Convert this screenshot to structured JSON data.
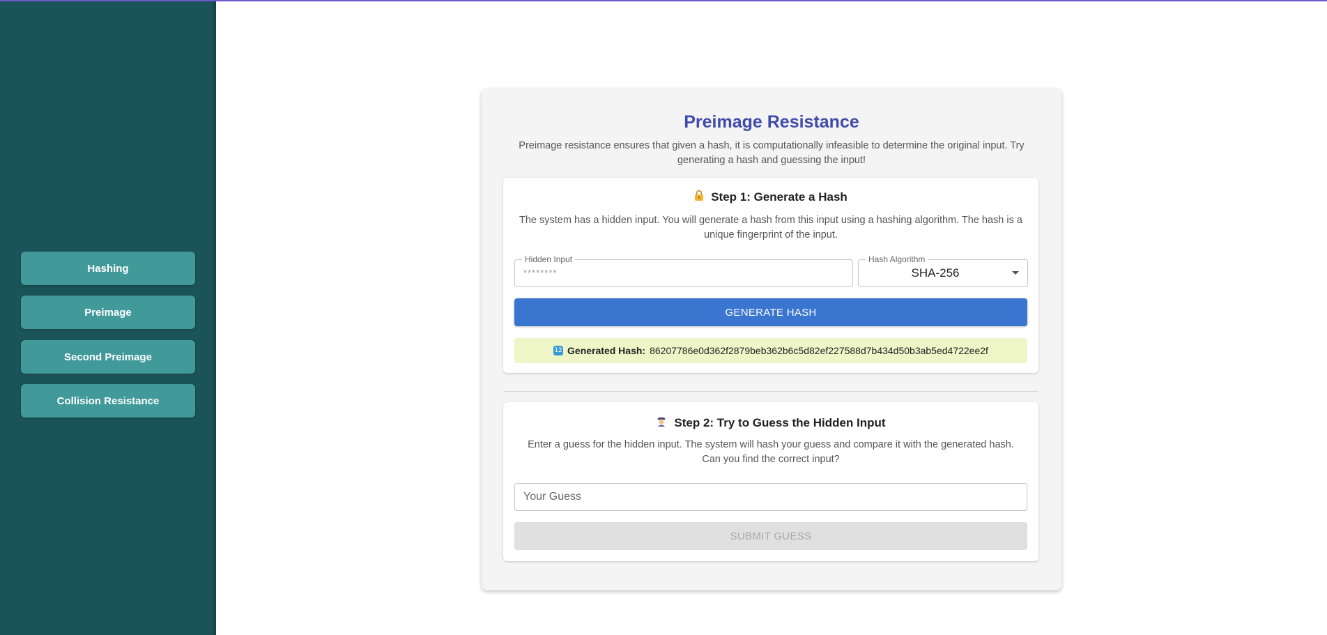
{
  "sidebar": {
    "items": [
      {
        "label": "Hashing"
      },
      {
        "label": "Preimage"
      },
      {
        "label": "Second Preimage"
      },
      {
        "label": "Collision Resistance"
      }
    ]
  },
  "page": {
    "title": "Preimage Resistance",
    "intro": "Preimage resistance ensures that given a hash, it is computationally infeasible to determine the original input. Try generating a hash and guessing the input!"
  },
  "step1": {
    "icon": "lock-icon",
    "title": "Step 1: Generate a Hash",
    "description": "The system has a hidden input. You will generate a hash from this input using a hashing algorithm. The hash is a unique fingerprint of the input.",
    "hidden_input_label": "Hidden Input",
    "hidden_input_value": "********",
    "algorithm_label": "Hash Algorithm",
    "algorithm_value": "SHA-256",
    "generate_button": "GENERATE HASH",
    "hash_label": "Generated Hash:",
    "hash_value": "86207786e0d362f2879beb362b6c5d82ef227588d7b434d50b3ab5ed4722ee2f"
  },
  "step2": {
    "icon": "detective-icon",
    "title": "Step 2: Try to Guess the Hidden Input",
    "description": "Enter a guess for the hidden input. The system will hash your guess and compare it with the generated hash. Can you find the correct input?",
    "guess_placeholder": "Your Guess",
    "submit_button": "SUBMIT GUESS"
  },
  "colors": {
    "sidebar": "#1b5458",
    "nav_button": "#41999a",
    "title": "#3f4bab",
    "primary_button": "#3a76d0",
    "hash_background": "#eef6c8"
  }
}
